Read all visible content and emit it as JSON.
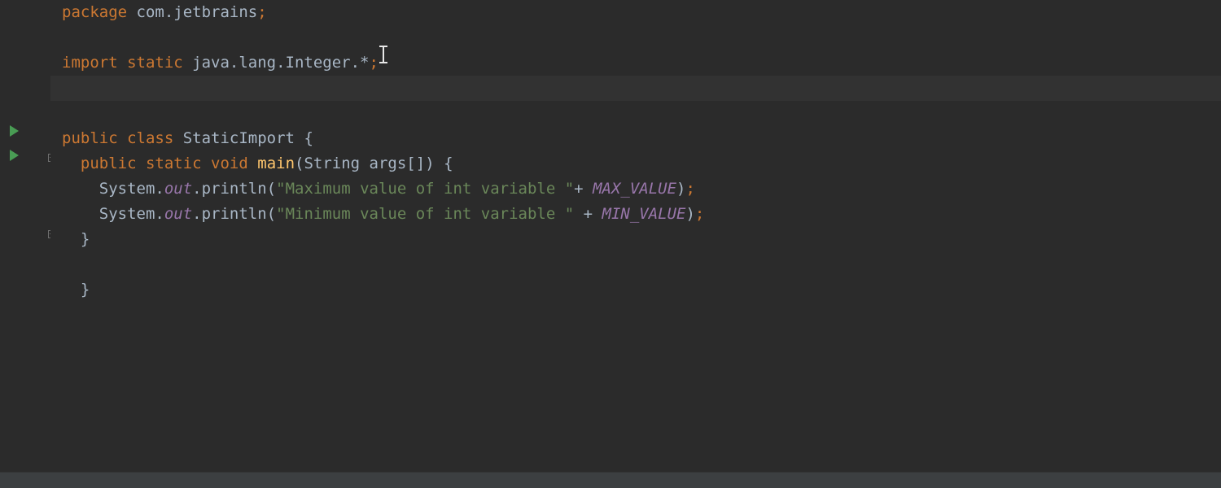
{
  "code": {
    "line1": {
      "package_kw": "package ",
      "package_name": "com.jetbrains",
      "semi": ";"
    },
    "line3": {
      "import_kw": "import static ",
      "import_path": "java.lang.Integer.*",
      "semi": ";"
    },
    "line6": {
      "public_kw": "public class ",
      "class_name": "StaticImport",
      "brace": " {"
    },
    "line7": {
      "indent": "  ",
      "public_kw": "public static ",
      "void_kw": "void ",
      "method": "main",
      "paren_open": "(",
      "param_type": "String",
      "param_rest": " args[]",
      "paren_close": ")",
      "brace": " {"
    },
    "line8": {
      "indent": "    ",
      "system": "System.",
      "out": "out",
      "dot_println": ".println(",
      "str": "\"Maximum value of int variable \"",
      "plus": "+ ",
      "const": "MAX_VALUE",
      "close": ")",
      "semi": ";"
    },
    "line9": {
      "indent": "    ",
      "system": "System.",
      "out": "out",
      "dot_println": ".println(",
      "str": "\"Minimum value of int variable \"",
      "plus": " + ",
      "const": "MIN_VALUE",
      "close": ")",
      "semi": ";"
    },
    "line10": {
      "indent": "  ",
      "brace": "}"
    },
    "line12": {
      "indent": "  ",
      "brace": "}"
    }
  }
}
